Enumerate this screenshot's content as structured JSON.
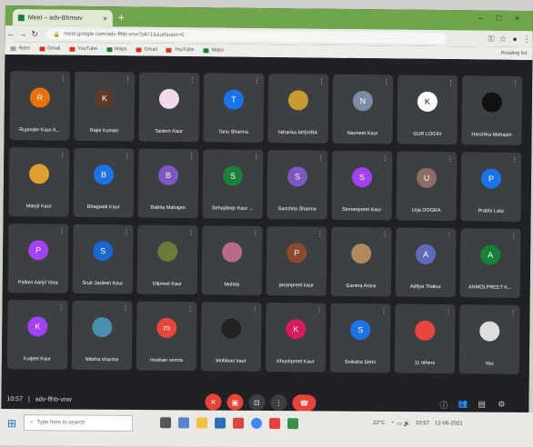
{
  "browser": {
    "tab_title": "Meet – adv-Bhmwv",
    "url": "meet.google.com/adv-ffhb-vnw?pli=1&authuser=0",
    "bookmarks": [
      "Apps",
      "Gmail",
      "YouTube",
      "Maps",
      "Gmail",
      "YouTube",
      "Maps"
    ],
    "reading_list": "Reading list"
  },
  "participants": [
    {
      "name": "Rupinder Kaur A...",
      "initial": "R",
      "color": "#e8710a"
    },
    {
      "name": "Rajni Kumari",
      "initial": "K",
      "color": "#5b3a29"
    },
    {
      "name": "Taslem Kaur",
      "initial": "",
      "color": "#f1d9ea"
    },
    {
      "name": "Tanu Sharma",
      "initial": "T",
      "color": "#1a73e8"
    },
    {
      "name": "Niharika MISHRA",
      "initial": "",
      "color": "#c69a2f"
    },
    {
      "name": "Navneet Kaur",
      "initial": "N",
      "color": "#7b8da6"
    },
    {
      "name": "GUR LOGIN",
      "initial": "K",
      "color": "#ffffff"
    },
    {
      "name": "Harshika Mahajan",
      "initial": "",
      "color": "#111111"
    },
    {
      "name": "Manjit Kaur",
      "initial": "",
      "color": "#e0a030"
    },
    {
      "name": "Bhagwati Kaur",
      "initial": "B",
      "color": "#1a73e8"
    },
    {
      "name": "Babita Mahajan",
      "initial": "B",
      "color": "#7e57c2"
    },
    {
      "name": "Sehajdeep Kaur ...",
      "initial": "S",
      "color": "#188038"
    },
    {
      "name": "Sanchita Sharma",
      "initial": "S",
      "color": "#7e57c2"
    },
    {
      "name": "Simranpreet Kaur",
      "initial": "S",
      "color": "#a142f4"
    },
    {
      "name": "Urja DOGRA",
      "initial": "U",
      "color": "#8d6e63"
    },
    {
      "name": "Prabhi Lata",
      "initial": "P",
      "color": "#1a73e8"
    },
    {
      "name": "Pallavi Aanjil Vora",
      "initial": "P",
      "color": "#a142f4"
    },
    {
      "name": "Sruti Jasleen Kaur",
      "initial": "S",
      "color": "#1967d2"
    },
    {
      "name": "Dilpreet Kaur",
      "initial": "",
      "color": "#6b7a3a"
    },
    {
      "name": "Mohita",
      "initial": "",
      "color": "#b76b88"
    },
    {
      "name": "jasanpreet kaur",
      "initial": "P",
      "color": "#8d4a2f"
    },
    {
      "name": "Garima Arora",
      "initial": "",
      "color": "#b08a5a"
    },
    {
      "name": "Aditya Thakur",
      "initial": "A",
      "color": "#5c6bc0"
    },
    {
      "name": "ANMOLPREET K...",
      "initial": "A",
      "color": "#188038"
    },
    {
      "name": "Kuljeet Kaur",
      "initial": "K",
      "color": "#a142f4"
    },
    {
      "name": "Nitisha sharma",
      "initial": "",
      "color": "#4a8fb0"
    },
    {
      "name": "muskan verma",
      "initial": "m",
      "color": "#e8453c"
    },
    {
      "name": "Moblean kaur",
      "initial": "",
      "color": "#222222"
    },
    {
      "name": "Khushpreet Kaur",
      "initial": "K",
      "color": "#d81b60"
    },
    {
      "name": "Snikaha Sethi",
      "initial": "S",
      "color": "#1a73e8"
    },
    {
      "name": "11 others",
      "initial": "",
      "color": "#e8453c"
    },
    {
      "name": "You",
      "initial": "",
      "color": "#dddddd"
    }
  ],
  "meeting": {
    "time": "10:57",
    "code": "adv-ffhb-vnw",
    "controls": [
      "mic-off",
      "camera-off",
      "present",
      "more",
      "leave"
    ]
  },
  "taskbar": {
    "search_placeholder": "Type here to search",
    "temperature": "22°C",
    "time": "10:57",
    "date": "12-06-2021"
  }
}
